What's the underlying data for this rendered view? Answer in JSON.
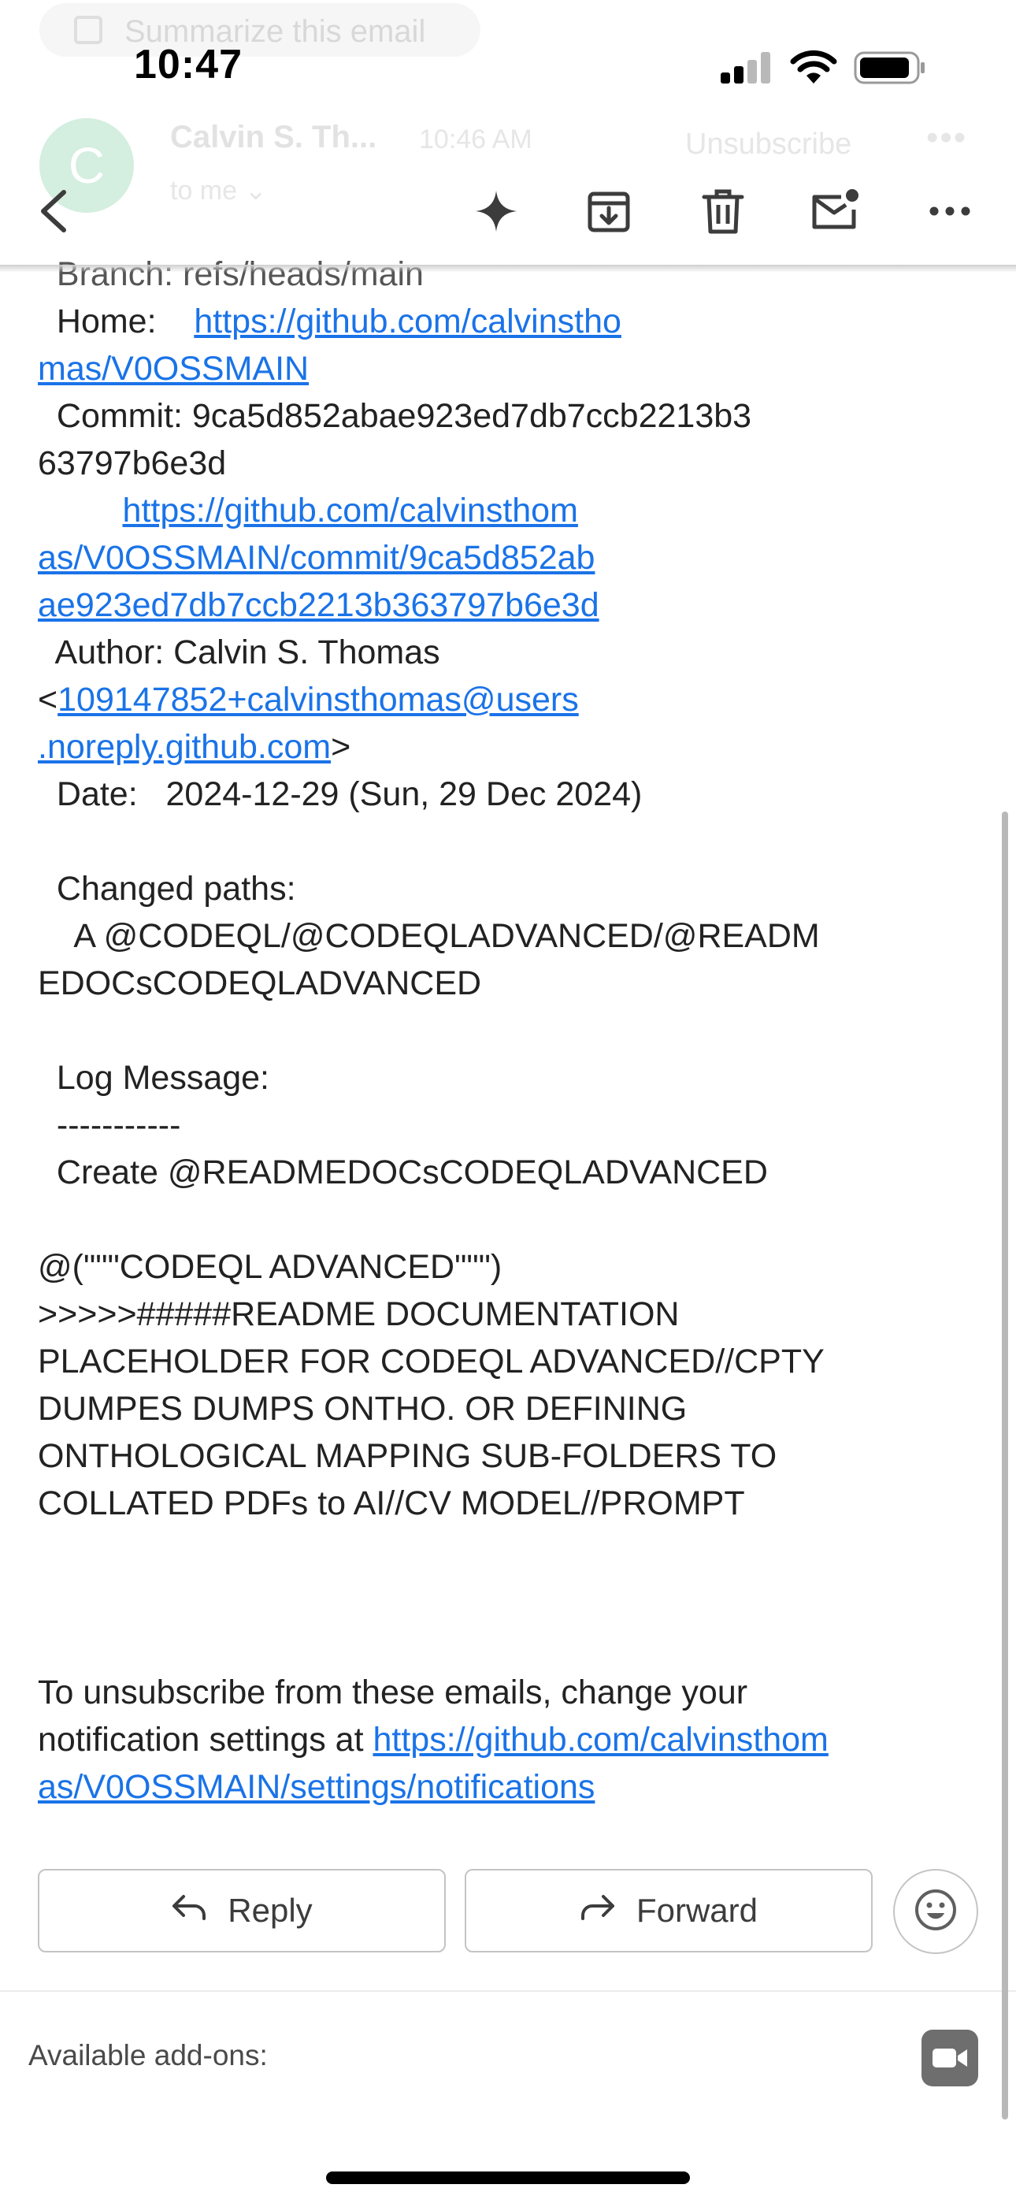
{
  "status": {
    "time": "10:47"
  },
  "ghost": {
    "summarize": "Summarize this email",
    "avatar_letter": "C",
    "sender": "Calvin S. Th...",
    "time": "10:46 AM",
    "to_me": "to me",
    "unsubscribe": "Unsubscribe"
  },
  "toolbar": {
    "icons": [
      "back-icon",
      "sparkle-icon",
      "archive-icon",
      "delete-icon",
      "mark-unread-icon",
      "more-icon"
    ]
  },
  "email": {
    "branch_line": "  Branch: refs/heads/main",
    "home_label": "  Home:   ",
    "home_link_1": "https://github.com/calvinstho",
    "home_link_2": "mas/V0OSSMAIN",
    "commit_line_1": "  Commit: 9ca5d852abae923ed7db7ccb2213b3",
    "commit_line_2": "63797b6e3d",
    "commit_link_1": "https://github.com/calvinsthom",
    "commit_link_2": "as/V0OSSMAIN/commit/9ca5d852ab",
    "commit_link_3": "ae923ed7db7ccb2213b363797b6e3d",
    "author_line": "  Author: Calvin S. Thomas",
    "author_lt": "<",
    "author_email_1": "109147852+calvinsthomas@users",
    "author_email_2": ".noreply.github.com",
    "author_gt": ">",
    "date_line": "  Date:   2024-12-29 (Sun, 29 Dec 2024)",
    "changed_paths_label": "  Changed paths:",
    "changed_path_1": "    A @CODEQL/@CODEQLADVANCED/@READM",
    "changed_path_2": "EDOCsCODEQLADVANCED",
    "log_label": "  Log Message:",
    "log_rule": "  -----------",
    "log_create": "  Create @READMEDOCsCODEQLADVANCED",
    "msg_1": "@(\"\"\"CODEQL ADVANCED\"\"\")",
    "msg_2": ">>>>>#####README DOCUMENTATION",
    "msg_3": "PLACEHOLDER FOR CODEQL ADVANCED//CPTY",
    "msg_4": "DUMPES DUMPS ONTHO. OR DEFINING",
    "msg_5": "ONTHOLOGICAL MAPPING SUB-FOLDERS TO",
    "msg_6": "COLLATED PDFs to AI//CV MODEL//PROMPT",
    "unsub_1": "To unsubscribe from these emails, change your",
    "unsub_2_text": "notification settings at ",
    "unsub_2_link": "https://github.com/calvinsthom",
    "unsub_3_link": "as/V0OSSMAIN/settings/notifications"
  },
  "actions": {
    "reply_label": "Reply",
    "forward_label": "Forward"
  },
  "footer": {
    "addons_label": "Available add-ons:"
  },
  "colors": {
    "link": "#1a73e8",
    "text": "#222222",
    "border": "#c4c4c4"
  }
}
